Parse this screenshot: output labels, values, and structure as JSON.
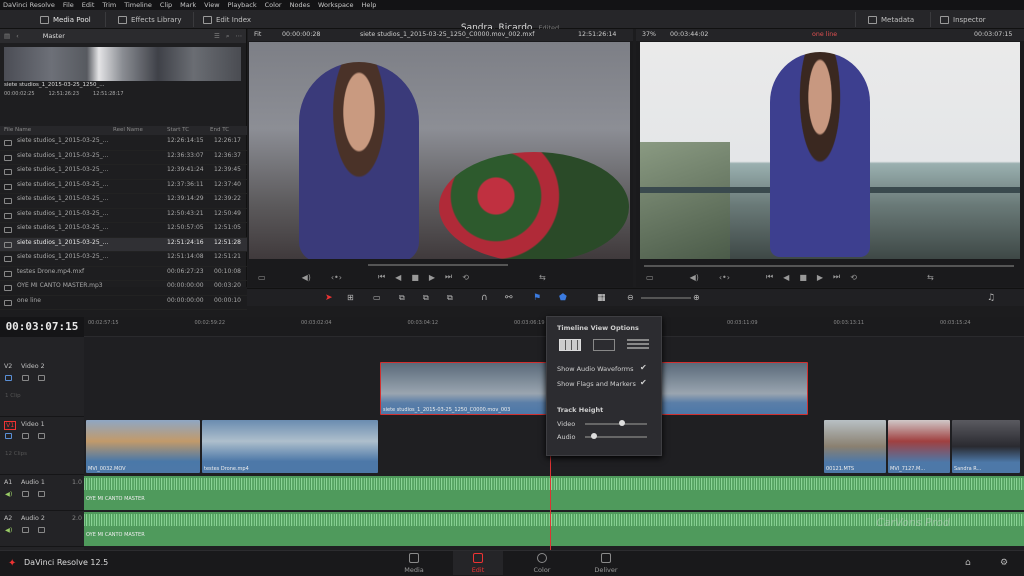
{
  "menu": [
    "DaVinci Resolve",
    "File",
    "Edit",
    "Trim",
    "Timeline",
    "Clip",
    "Mark",
    "View",
    "Playback",
    "Color",
    "Nodes",
    "Workspace",
    "Help"
  ],
  "toolbar": {
    "media_pool": "Media Pool",
    "effects_library": "Effects Library",
    "edit_index": "Edit Index",
    "project_name": "Sandra, Ricardo",
    "project_status": "Edited",
    "metadata": "Metadata",
    "inspector": "Inspector"
  },
  "pool": {
    "bin": "Master",
    "clip_name": "siete studios_1_2015-03-25_1250_...",
    "clip_tc1": "00:00:02:25",
    "clip_tc2": "12:51:26:23",
    "clip_tc3": "12:51:28:17",
    "columns": [
      "File Name",
      "Reel Name",
      "Start TC",
      "End TC"
    ],
    "rows": [
      {
        "name": "siete studios_1_2015-03-25_...",
        "start": "12:26:14:15",
        "end": "12:26:17"
      },
      {
        "name": "siete studios_1_2015-03-25_...",
        "start": "12:36:33:07",
        "end": "12:36:37"
      },
      {
        "name": "siete studios_1_2015-03-25_...",
        "start": "12:39:41:24",
        "end": "12:39:45"
      },
      {
        "name": "siete studios_1_2015-03-25_...",
        "start": "12:37:36:11",
        "end": "12:37:40"
      },
      {
        "name": "siete studios_1_2015-03-25_...",
        "start": "12:39:14:29",
        "end": "12:39:22"
      },
      {
        "name": "siete studios_1_2015-03-25_...",
        "start": "12:50:43:21",
        "end": "12:50:49"
      },
      {
        "name": "siete studios_1_2015-03-25_...",
        "start": "12:50:57:05",
        "end": "12:51:05"
      },
      {
        "name": "siete studios_1_2015-03-25_...",
        "start": "12:51:24:16",
        "end": "12:51:28",
        "selected": true
      },
      {
        "name": "siete studios_1_2015-03-25_...",
        "start": "12:51:14:08",
        "end": "12:51:21"
      },
      {
        "name": "testes Drone.mp4.mxf",
        "start": "00:06:27:23",
        "end": "00:10:08"
      },
      {
        "name": "OYE MI CANTO MASTER.mp3",
        "start": "00:00:00:00",
        "end": "00:03:20"
      },
      {
        "name": "one line",
        "start": "00:00:00:00",
        "end": "00:00:10"
      }
    ]
  },
  "source": {
    "zoom": "Fit",
    "tc": "00:00:00:28",
    "title": "siete studios_1_2015-03-25_1250_C0000.mov_002.mxf",
    "tc_right": "12:51:26:14"
  },
  "timeline_viewer": {
    "zoom": "37%",
    "tc": "00:03:44:02",
    "title": "one line",
    "tc_right": "00:03:07:15"
  },
  "timeline": {
    "timecode": "00:03:07:15",
    "ticks": [
      "00:02:57:15",
      "00:02:59:22",
      "00:03:02:04",
      "00:03:04:12",
      "00:03:06:19",
      "00:03:09:01",
      "00:03:11:09",
      "00:03:13:11",
      "00:03:15:24"
    ],
    "tracks": [
      {
        "id": "V2",
        "name": "Video 2",
        "info": "1 Clip"
      },
      {
        "id": "V1",
        "name": "Video 1",
        "info": "12 Clips"
      },
      {
        "id": "A1",
        "name": "Audio 1",
        "level": "1.0"
      },
      {
        "id": "A2",
        "name": "Audio 2",
        "level": "2.0"
      }
    ],
    "clips": {
      "v2": "siete studios_1_2015-03-25_1250_C0000.mov_003",
      "v1a": "MVI_0032.MOV",
      "v1b": "testes Drone.mp4",
      "v1c": "00121.MTS",
      "v1d": "MVI_7127.M...",
      "v1e": "Sandra R...",
      "a1": "OYE MI CANTO MASTER",
      "a2": "OYE MI CANTO MASTER"
    }
  },
  "popup": {
    "title": "Timeline View Options",
    "show_waveforms": "Show Audio Waveforms",
    "show_flags": "Show Flags and Markers",
    "track_height": "Track Height",
    "video": "Video",
    "audio": "Audio"
  },
  "pages": [
    "Media",
    "Edit",
    "Color",
    "Deliver"
  ],
  "app_name": "DaVinci Resolve 12.5",
  "watermark": "CarVons Prod"
}
